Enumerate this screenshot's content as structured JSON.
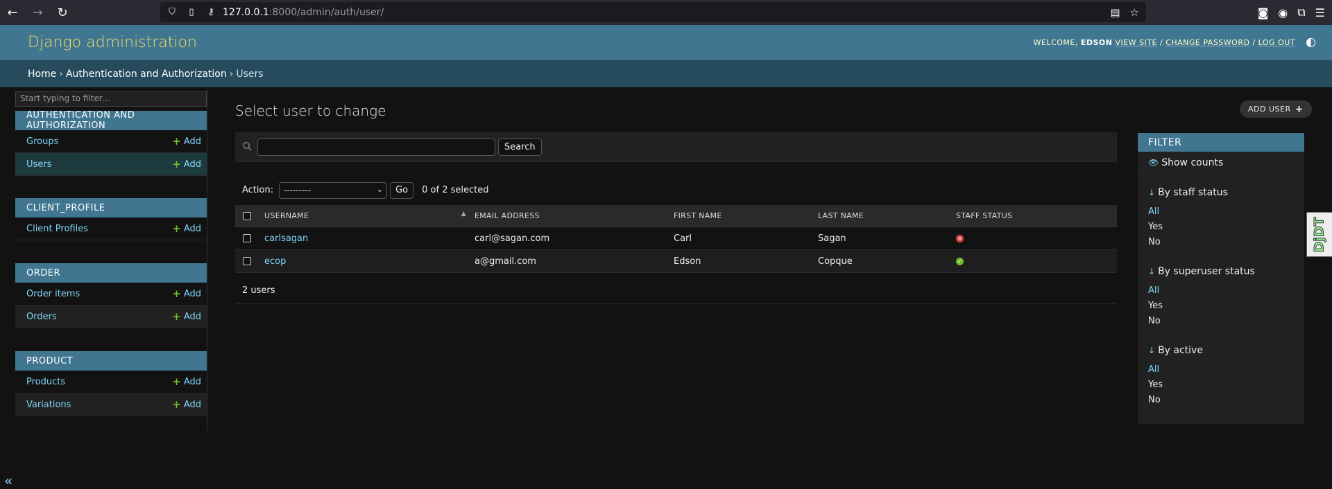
{
  "browser": {
    "url_host": "127.0.0.1",
    "url_rest": ":8000/admin/auth/user/"
  },
  "header": {
    "brand": "Django administration",
    "welcome": "WELCOME,",
    "username": "EDSON",
    "view_site": "VIEW SITE",
    "change_password": "CHANGE PASSWORD",
    "log_out": "LOG OUT",
    "sep": "/"
  },
  "breadcrumbs": {
    "home": "Home",
    "app": "Authentication and Authorization",
    "current": "Users",
    "sep": "›"
  },
  "sidebar": {
    "filter_placeholder": "Start typing to filter…",
    "add_label": "Add",
    "modules": [
      {
        "caption": "AUTHENTICATION AND AUTHORIZATION",
        "items": [
          "Groups",
          "Users"
        ]
      },
      {
        "caption": "CLIENT_PROFILE",
        "items": [
          "Client Profiles"
        ]
      },
      {
        "caption": "ORDER",
        "items": [
          "Order items",
          "Orders"
        ]
      },
      {
        "caption": "PRODUCT",
        "items": [
          "Products",
          "Variations"
        ]
      }
    ],
    "collapse": "«"
  },
  "main": {
    "title": "Select user to change",
    "add_user": "ADD USER",
    "search_button": "Search",
    "action_label": "Action:",
    "action_value": "---------",
    "go_button": "Go",
    "selected_counter": "0 of 2 selected",
    "columns": [
      "USERNAME",
      "EMAIL ADDRESS",
      "FIRST NAME",
      "LAST NAME",
      "STAFF STATUS"
    ],
    "rows": [
      {
        "username": "carlsagan",
        "email": "carl@sagan.com",
        "first": "Carl",
        "last": "Sagan",
        "staff": false
      },
      {
        "username": "ecop",
        "email": "a@gmail.com",
        "first": "Edson",
        "last": "Copque",
        "staff": true
      }
    ],
    "paginator": "2 users"
  },
  "filter": {
    "header": "FILTER",
    "show_counts": "Show counts",
    "sections": [
      {
        "title": "By staff status",
        "options": [
          "All",
          "Yes",
          "No"
        ]
      },
      {
        "title": "By superuser status",
        "options": [
          "All",
          "Yes",
          "No"
        ]
      },
      {
        "title": "By active",
        "options": [
          "All",
          "Yes",
          "No"
        ]
      }
    ]
  },
  "djdt": "DjDT",
  "colors": {
    "header": "#417690",
    "breadcrumbs": "#264b5d",
    "brand": "#f5dd5d",
    "link": "#81d4fa",
    "add_green": "#70bf2b",
    "status_no": "#dd4646"
  }
}
